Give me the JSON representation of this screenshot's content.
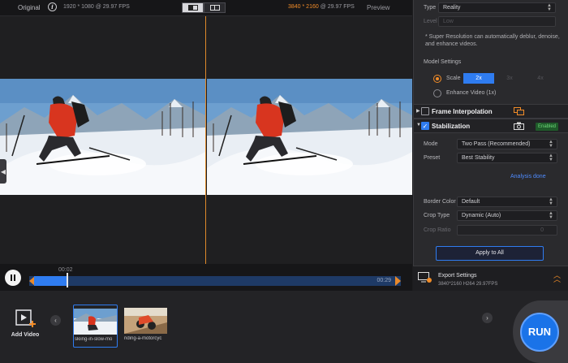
{
  "topbar": {
    "original_label": "Original",
    "info_glyph": "i",
    "source_info": "1920 * 1080 @ 29.97 FPS",
    "output_res": "3840 * 2160",
    "output_fps": " @ 29.97 FPS",
    "preview_label": "Preview"
  },
  "playback": {
    "current_time": "00:02",
    "end_time": "00:29",
    "progress": 0.09
  },
  "panel": {
    "type_label": "Type",
    "type_value": "Reality",
    "level_label": "Level",
    "level_value": "Low",
    "note": "* Super Resolution can automatically deblur, denoise, and enhance videos.",
    "model_settings_label": "Model Settings",
    "scale_label": "Scale",
    "scale_options": [
      "2x",
      "3x",
      "4x"
    ],
    "enhance_label": "Enhance Video (1x)",
    "frame_interp_title": "Frame Interpolation",
    "stabilization_title": "Stabilization",
    "enabled_badge": "Enabled",
    "mode_label": "Mode",
    "mode_value": "Two Pass (Recommended)",
    "preset_label": "Preset",
    "preset_value": "Best Stability",
    "analysis_status": "Analysis done",
    "border_color_label": "Border Color",
    "border_color_value": "Default",
    "crop_type_label": "Crop Type",
    "crop_type_value": "Dynamic (Auto)",
    "crop_ratio_label": "Crop Ratio",
    "crop_ratio_value": "0",
    "apply_all_label": "Apply to All",
    "checkmark_glyph": "✓"
  },
  "export": {
    "title": "Export Settings",
    "details": "3840*2160   H264   29.97FPS"
  },
  "bottom": {
    "add_video_label": "Add Video",
    "thumbs": [
      "skiing-in-slow-mo",
      "riding-a-motorcyc"
    ],
    "run_label": "RUN"
  },
  "colors": {
    "accent_blue": "#2f7cf0",
    "accent_orange": "#f28c28",
    "enabled_green": "#6fd87a"
  }
}
